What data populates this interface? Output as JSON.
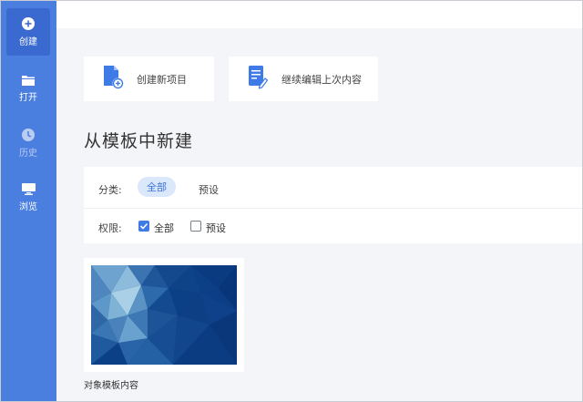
{
  "sidebar": {
    "items": [
      {
        "label": "创建",
        "icon": "plus-circle-icon"
      },
      {
        "label": "打开",
        "icon": "folder-icon"
      },
      {
        "label": "历史",
        "icon": "clock-icon"
      },
      {
        "label": "浏览",
        "icon": "monitor-icon"
      }
    ]
  },
  "actions": {
    "create_new": "创建新项目",
    "continue_edit": "继续编辑上次内容"
  },
  "section": {
    "title": "从模板中新建"
  },
  "filters": {
    "category_label": "分类:",
    "category_options": [
      "全部",
      "预设"
    ],
    "permission_label": "权限:",
    "permission_options": [
      {
        "label": "全部",
        "checked": true
      },
      {
        "label": "预设",
        "checked": false
      }
    ]
  },
  "templates": [
    {
      "name": "对象模板内容"
    }
  ],
  "colors": {
    "sidebar": "#4a7fe0",
    "sidebar_active": "#3a6ad0",
    "accent": "#3f7be6",
    "pill_bg": "#dbe7fb"
  }
}
